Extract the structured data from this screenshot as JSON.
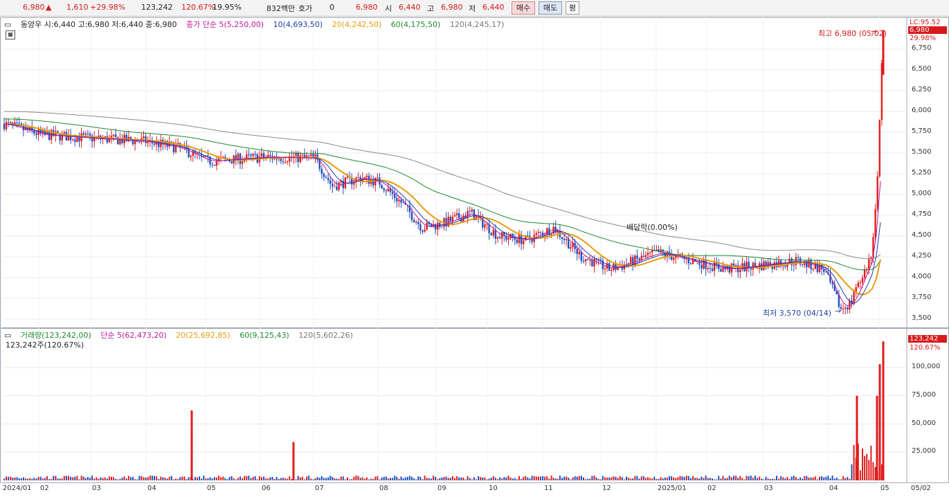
{
  "toolbar": {
    "price": "6,980",
    "change": "1,610",
    "change_pct": "+29.98%",
    "volume": "123,242",
    "volume_ratio": "120.67%",
    "turnover_pct": "19.95%",
    "amount": "832백만",
    "quote_label": "호가",
    "quote_value": "0",
    "quote_price": "6,980",
    "open_label": "시",
    "open": "6,440",
    "high_label": "고",
    "high": "6,980",
    "low_label": "저",
    "low": "6,440",
    "buy_label": "매수",
    "sell_label": "매도",
    "flat_label": "평"
  },
  "price_panel": {
    "title": "동양우 시:6,440 고:6,980 저:6,440 종:6,980",
    "ma_legend": [
      "종가 단순 5(5,250,00)",
      "10(4,693,50)",
      "20(4,242,50)",
      "60(4,175,50)",
      "120(4,245,17)"
    ],
    "ma_colors": [
      "#c0169b",
      "#1f3fa5",
      "#e89b0a",
      "#1a8a2c",
      "#8a8a8a"
    ],
    "high_note": "최고 6,980 (05/02)",
    "low_note": "최저 3,570 (04/14)",
    "dividend_note": "배당락(0.00%)",
    "current_tag": "6,980",
    "lc_tag": "LC:95.52",
    "pct_tag": "29.98%"
  },
  "volume_panel": {
    "title": "거래량(123,242,00)",
    "ma_legend": [
      "단순 5(62,473,20)",
      "20(25,692,85)",
      "60(9,125,43)",
      "120(5,602,26)"
    ],
    "sub": "123,242주(120.67%)",
    "current_tag": "123,242",
    "pct_tag": "120.67%"
  },
  "price_axis": [
    "6,750",
    "6,500",
    "6,250",
    "6,000",
    "5,750",
    "5,500",
    "5,250",
    "5,000",
    "4,750",
    "4,500",
    "4,250",
    "4,000",
    "3,750",
    "3,500"
  ],
  "volume_axis": [
    "100,000",
    "75,000",
    "50,000",
    "25,000"
  ],
  "x_axis": [
    "2024/01",
    "02",
    "03",
    "04",
    "05",
    "06",
    "07",
    "08",
    "09",
    "10",
    "11",
    "12",
    "2025/01",
    "02",
    "03",
    "04",
    "05",
    "05/02"
  ],
  "colors": {
    "up": "#e01b1b",
    "down": "#1f4fbf",
    "border": "#9fa7b3",
    "grid": "#dde2ea"
  }
}
